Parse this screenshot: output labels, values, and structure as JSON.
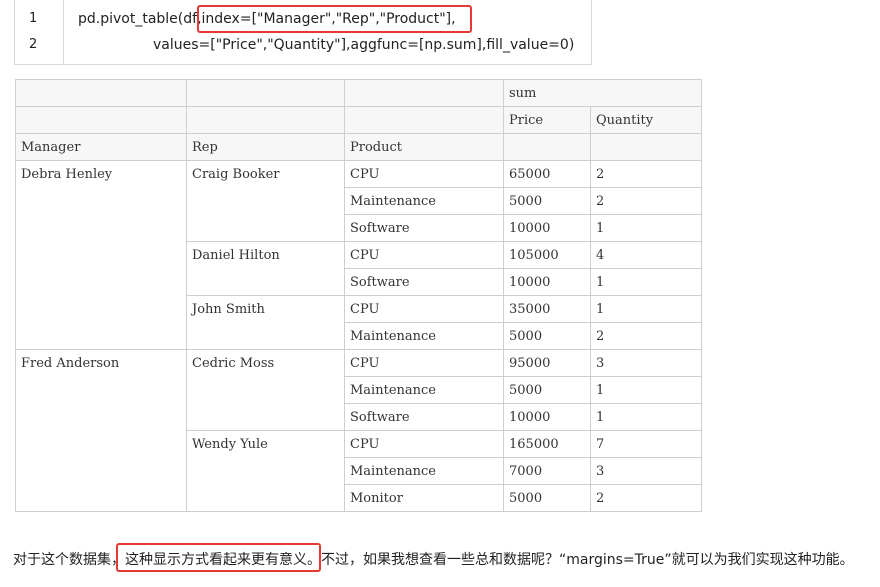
{
  "code": {
    "line_numbers": [
      "1",
      "2"
    ],
    "line1_prefix": "pd.pivot_table(df,",
    "line1_highlight": "index=[\"Manager\",\"Rep\",\"Product\"],",
    "line2": "values=[\"Price\",\"Quantity\"],aggfunc=[np.sum],fill_value=0)"
  },
  "table": {
    "header_top": "sum",
    "col_price": "Price",
    "col_quantity": "Quantity",
    "col_manager": "Manager",
    "col_rep": "Rep",
    "col_product": "Product",
    "rows": [
      {
        "product": "CPU",
        "price": "65000",
        "qty": "2"
      },
      {
        "product": "Maintenance",
        "price": "5000",
        "qty": "2"
      },
      {
        "product": "Software",
        "price": "10000",
        "qty": "1"
      },
      {
        "product": "CPU",
        "price": "105000",
        "qty": "4"
      },
      {
        "product": "Software",
        "price": "10000",
        "qty": "1"
      },
      {
        "product": "CPU",
        "price": "35000",
        "qty": "1"
      },
      {
        "product": "Maintenance",
        "price": "5000",
        "qty": "2"
      },
      {
        "product": "CPU",
        "price": "95000",
        "qty": "3"
      },
      {
        "product": "Maintenance",
        "price": "5000",
        "qty": "1"
      },
      {
        "product": "Software",
        "price": "10000",
        "qty": "1"
      },
      {
        "product": "CPU",
        "price": "165000",
        "qty": "7"
      },
      {
        "product": "Maintenance",
        "price": "7000",
        "qty": "3"
      },
      {
        "product": "Monitor",
        "price": "5000",
        "qty": "2"
      }
    ],
    "managers": [
      "Debra Henley",
      "Fred Anderson"
    ],
    "reps": [
      "Craig Booker",
      "Daniel Hilton",
      "John Smith",
      "Cedric Moss",
      "Wendy Yule"
    ]
  },
  "paragraph": {
    "before": "对于这个数据集，",
    "highlight": "这种显示方式看起来更有意义。",
    "after": "不过，如果我想查看一些总和数据呢？“margins=True”就可以为我们实现这种功能。"
  },
  "colors": {
    "highlight_border": "#e53935"
  }
}
